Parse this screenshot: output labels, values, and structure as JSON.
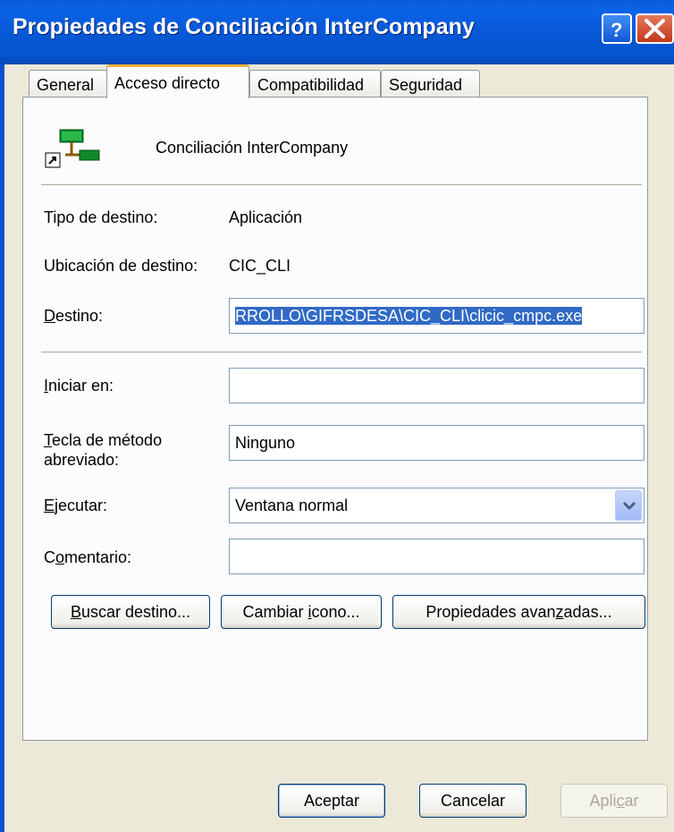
{
  "window": {
    "title": "Propiedades de Conciliación InterCompany"
  },
  "titlebar_buttons": {
    "help": "?",
    "close": "X"
  },
  "tabs": [
    {
      "label": "General"
    },
    {
      "label": "Acceso directo",
      "active": true
    },
    {
      "label": "Compatibilidad"
    },
    {
      "label": "Seguridad"
    }
  ],
  "shortcut": {
    "name": "Conciliación InterCompany",
    "icon": "application-shortcut-icon",
    "target_type_label": "Tipo de destino:",
    "target_type_value": "Aplicación",
    "target_location_label": "Ubicación de destino:",
    "target_location_value": "CIC_CLI",
    "target_label_pre": "",
    "target_label_key": "D",
    "target_label_post": "estino:",
    "target_value": "RROLLO\\GIFRSDESA\\CIC_CLI\\clicic_cmpc.exe",
    "start_in_label_pre": "",
    "start_in_label_key": "I",
    "start_in_label_post": "niciar en:",
    "start_in_value": "",
    "hotkey_label_line1_pre": "",
    "hotkey_label_line1_key": "T",
    "hotkey_label_line1_post": "ecla de método",
    "hotkey_label_line2": "abreviado:",
    "hotkey_value": "Ninguno",
    "run_label_pre": "",
    "run_label_key": "E",
    "run_label_post": "jecutar:",
    "run_value": "Ventana normal",
    "comment_label_pre": "C",
    "comment_label_key": "o",
    "comment_label_post": "mentario:",
    "comment_value": ""
  },
  "action_buttons": {
    "find_target_pre": "",
    "find_target_key": "B",
    "find_target_post": "uscar destino...",
    "change_icon_pre": "Cambiar ",
    "change_icon_key": "i",
    "change_icon_post": "cono...",
    "advanced_pre": "Propiedades avan",
    "advanced_key": "z",
    "advanced_post": "adas..."
  },
  "dialog_buttons": {
    "ok": "Aceptar",
    "cancel": "Cancelar",
    "apply_pre": "Apli",
    "apply_key": "c",
    "apply_post": "ar",
    "apply_disabled": true
  }
}
